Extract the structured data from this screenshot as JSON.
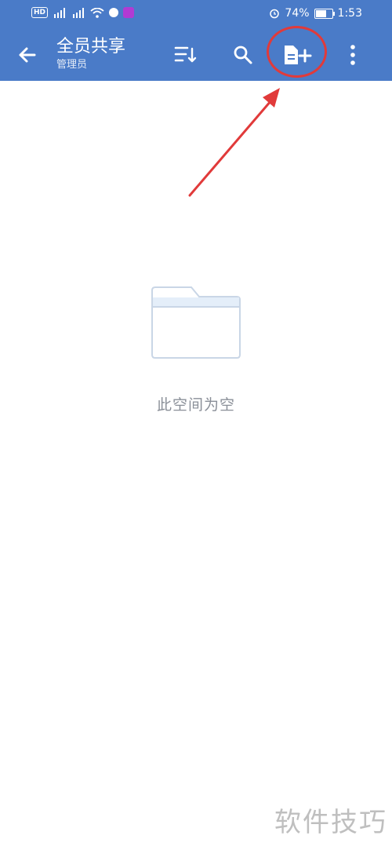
{
  "status_bar": {
    "hd_badge": "HD",
    "battery_percent": "74%",
    "battery_level": 0.74,
    "time": "1:53"
  },
  "app_bar": {
    "title": "全员共享",
    "subtitle": "管理员",
    "icons": [
      "back-arrow-icon",
      "sort-icon",
      "search-icon",
      "new-document-icon",
      "more-vertical-icon"
    ]
  },
  "empty_state": {
    "message": "此空间为空",
    "icon": "empty-folder-icon"
  },
  "watermark": "软件技巧",
  "colors": {
    "app_bar": "#4a7bc8",
    "annotation": "#e13a3a",
    "empty_text": "#8a8f98"
  }
}
